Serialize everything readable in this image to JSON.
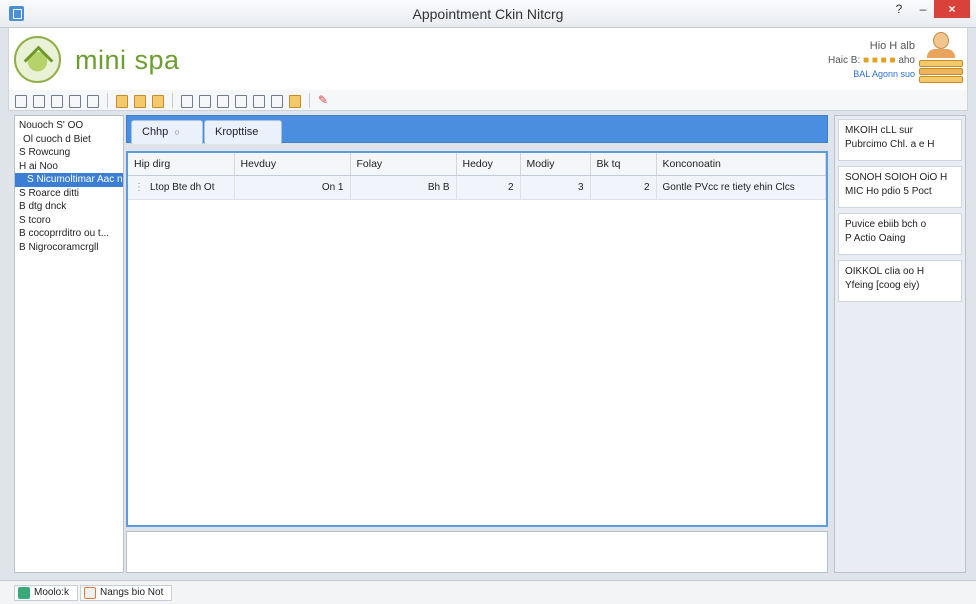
{
  "window": {
    "title": "Appointment Ckin Nitcrg",
    "help": "?",
    "minimize": "–",
    "close": "×"
  },
  "brand": {
    "name": "mini spa",
    "info_line1": "Hio H alb",
    "info_line2": "Haic B:",
    "info_line2_highlight": "■ ■ ■ ■",
    "info_line2_tail": "aho",
    "info_line3": "BAL Agonn suo"
  },
  "toolbar": {
    "buttons": [
      "new-icon",
      "save-icon",
      "copy-icon",
      "table-icon",
      "edit-icon",
      "folder-icon",
      "folder-icon",
      "folder-icon",
      "lock-icon",
      "search-icon",
      "check-icon",
      "refresh-icon",
      "undo-icon",
      "redo-icon",
      "tag-icon",
      "calendar-icon",
      "color-icon"
    ]
  },
  "sidebar": {
    "items": [
      {
        "label": "Nouoch S' OO",
        "selected": false,
        "sub": false
      },
      {
        "label": "Ol cuoch d Biet",
        "selected": false,
        "sub": true
      },
      {
        "label": "S Rowcung",
        "selected": false,
        "sub": false
      },
      {
        "label": "H ai Noo",
        "selected": false,
        "sub": false
      },
      {
        "label": "S Nicumoltimar Aac n",
        "selected": true,
        "sub": false
      },
      {
        "label": "S Roarce ditti",
        "selected": false,
        "sub": false
      },
      {
        "label": "B dtg dnck",
        "selected": false,
        "sub": false
      },
      {
        "label": "S tcoro",
        "selected": false,
        "sub": false
      },
      {
        "label": "B cocoprrditro ou t...",
        "selected": false,
        "sub": false
      },
      {
        "label": "B Nigrocoramcrgll",
        "selected": false,
        "sub": false
      }
    ]
  },
  "tabs": [
    {
      "label": "Chhp",
      "close": "○"
    },
    {
      "label": "Kropttise"
    }
  ],
  "grid": {
    "columns": [
      "Hip dirg",
      "Hevduy",
      "Folay",
      "Hedoy",
      "Modiy",
      "Bk tq",
      "Konconoatin"
    ],
    "rows": [
      {
        "marker": "⋮",
        "cells": [
          "Ltop Bte dh Ot",
          "On 1",
          "Bh B",
          "2",
          "3",
          "2",
          "Gontle PVcc re tiety ehin Clcs"
        ]
      }
    ]
  },
  "right_panel": {
    "cards": [
      {
        "line1": "MKOIH cLL sur",
        "line2": "Pubrcimo Chl. a e H"
      },
      {
        "line1": "SONOH SOIOH OiO H",
        "line2": "MIC Ho pdio 5 Poct"
      },
      {
        "line1": "Puvice ebiib bch o",
        "line2": "P Actio Oaing"
      },
      {
        "line1": "OIKKOL cIia oo H",
        "line2": "Yfeing [coog eiy)"
      }
    ]
  },
  "statusbar": {
    "items": [
      {
        "label": "Moolo:k"
      },
      {
        "label": "Nangs bio Not"
      }
    ]
  },
  "colors": {
    "accent": "#4a8fdf",
    "brand": "#6c9e2f",
    "selection": "#3a7fd5",
    "close": "#d9413b"
  }
}
